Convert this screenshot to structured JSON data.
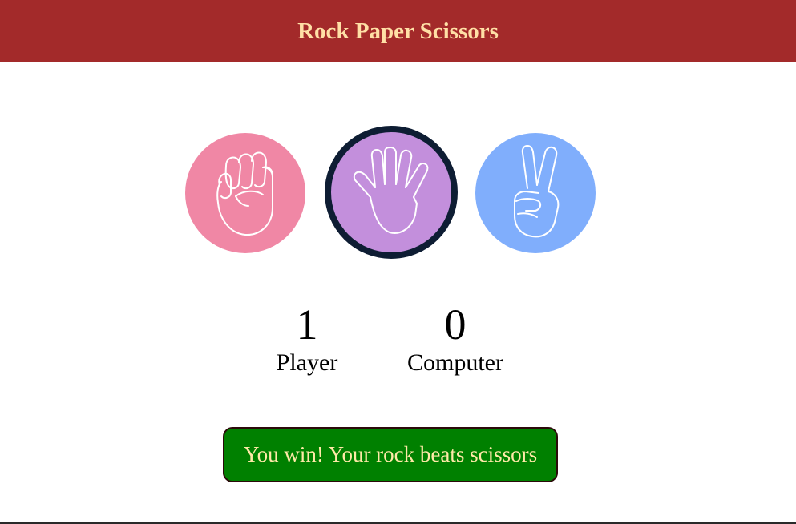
{
  "colors": {
    "header_bg": "#a32a2a",
    "header_text": "#ffe0a6",
    "rock_bg": "#f087a5",
    "paper_bg": "#c38fdc",
    "paper_selected_border": "#0e1d33",
    "scissors_bg": "#80aefc",
    "result_bg": "#008000",
    "result_text": "#ffe9a8"
  },
  "header": {
    "title": "Rock Paper Scissors"
  },
  "choices": [
    {
      "id": "rock",
      "icon": "fist-icon",
      "selected": false
    },
    {
      "id": "paper",
      "icon": "open-hand-icon",
      "selected": true
    },
    {
      "id": "scissors",
      "icon": "peace-sign-icon",
      "selected": false
    }
  ],
  "scores": {
    "player": {
      "value": "1",
      "label": "Player"
    },
    "computer": {
      "value": "0",
      "label": "Computer"
    }
  },
  "result": {
    "message": "You win! Your rock beats scissors"
  }
}
